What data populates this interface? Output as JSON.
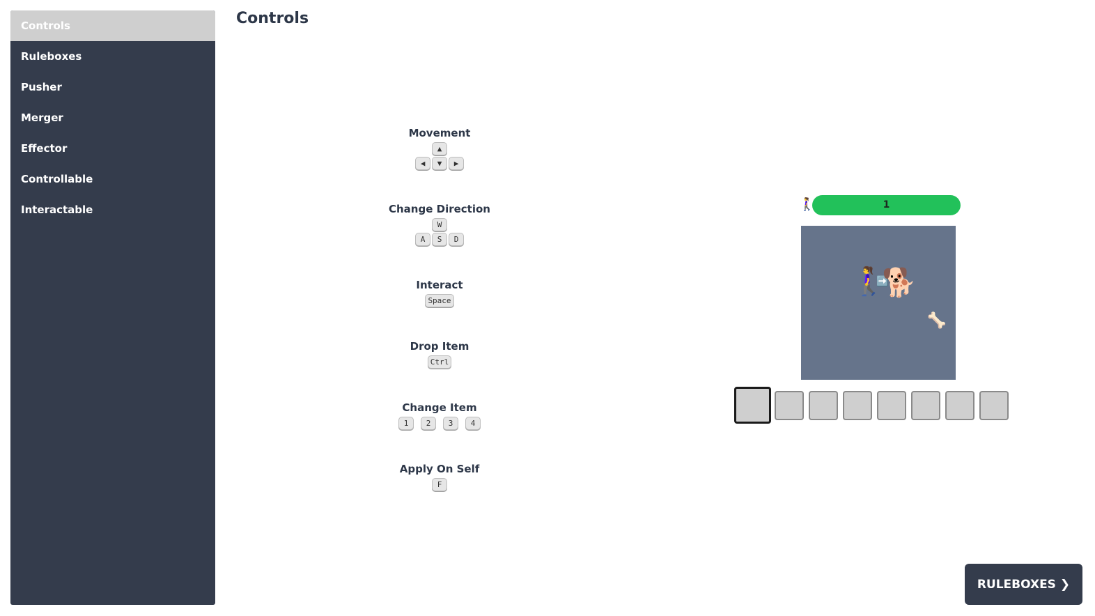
{
  "sidebar": {
    "items": [
      {
        "label": "Controls",
        "active": true
      },
      {
        "label": "Ruleboxes"
      },
      {
        "label": "Pusher"
      },
      {
        "label": "Merger"
      },
      {
        "label": "Effector"
      },
      {
        "label": "Controllable"
      },
      {
        "label": "Interactable"
      }
    ]
  },
  "page": {
    "title": "Controls"
  },
  "controls": [
    {
      "label": "Movement",
      "keys": [
        "▲",
        "◀",
        "▼",
        "▶"
      ]
    },
    {
      "label": "Change Direction",
      "keys": [
        "W",
        "A",
        "S",
        "D"
      ]
    },
    {
      "label": "Interact",
      "keys": [
        "Space"
      ]
    },
    {
      "label": "Drop Item",
      "keys": [
        "Ctrl"
      ]
    },
    {
      "label": "Change Item",
      "keys": [
        "1",
        "2",
        "3",
        "4"
      ]
    },
    {
      "label": "Apply On Self",
      "keys": [
        "F"
      ]
    }
  ],
  "game": {
    "player_icon": "🚶‍♀️",
    "health_value": "1",
    "entities": {
      "player": "🚶‍♀️",
      "push_arrow": "➡️",
      "dog": "🐕",
      "bone": "🦴"
    },
    "inventory_slots": 8,
    "selected_slot": 0
  },
  "next_button": {
    "label": "RULEBOXES",
    "arrow": "❯"
  },
  "colors": {
    "sidebar_bg": "#343c4c",
    "sidebar_active": "#cfcfcf",
    "health_bar": "#22c15a",
    "board_bg": "#66748b"
  }
}
